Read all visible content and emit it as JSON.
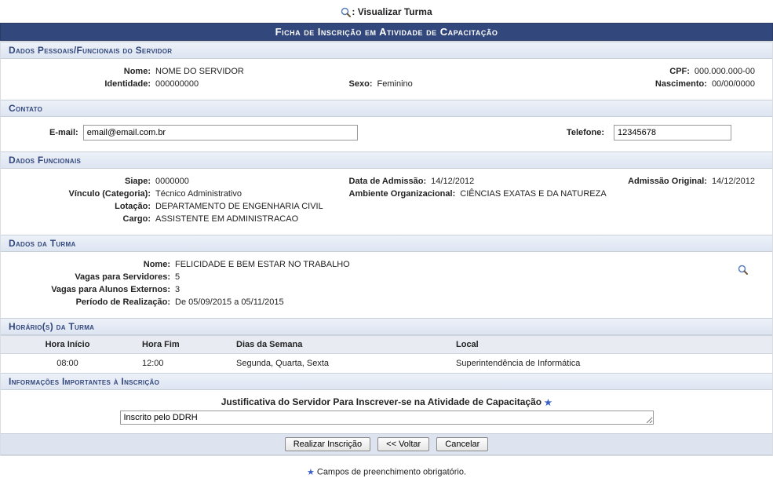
{
  "top_link": {
    "label": ": Visualizar Turma"
  },
  "main_header": "Ficha de Inscrição em Atividade de Capacitação",
  "sections": {
    "pessoais_header": "Dados Pessoais/Funcionais do Servidor",
    "contato_header": "Contato",
    "funcionais_header": "Dados Funcionais",
    "turma_header": "Dados da Turma",
    "horarios_header": "Horário(s) da Turma",
    "info_header": "Informações Importantes à Inscrição"
  },
  "pessoais": {
    "nome_label": "Nome:",
    "nome_value": "NOME DO SERVIDOR",
    "cpf_label": "CPF:",
    "cpf_value": "000.000.000-00",
    "identidade_label": "Identidade:",
    "identidade_value": "000000000",
    "sexo_label": "Sexo:",
    "sexo_value": "Feminino",
    "nascimento_label": "Nascimento:",
    "nascimento_value": "00/00/0000"
  },
  "contato": {
    "email_label": "E-mail:",
    "email_value": "email@email.com.br",
    "telefone_label": "Telefone:",
    "telefone_value": "12345678"
  },
  "funcionais": {
    "siape_label": "Siape:",
    "siape_value": "0000000",
    "admissao_label": "Data de Admissão:",
    "admissao_value": "14/12/2012",
    "admissao_orig_label": "Admissão Original:",
    "admissao_orig_value": "14/12/2012",
    "vinculo_label": "Vínculo (Categoria):",
    "vinculo_value": "Técnico Administrativo",
    "ambiente_label": "Ambiente Organizacional:",
    "ambiente_value": "CIÊNCIAS EXATAS E DA NATUREZA",
    "lotacao_label": "Lotação:",
    "lotacao_value": "DEPARTAMENTO DE ENGENHARIA CIVIL",
    "cargo_label": "Cargo:",
    "cargo_value": "ASSISTENTE EM ADMINISTRACAO"
  },
  "turma": {
    "nome_label": "Nome:",
    "nome_value": "FELICIDADE E BEM ESTAR NO TRABALHO",
    "vagas_serv_label": "Vagas para Servidores:",
    "vagas_serv_value": "5",
    "vagas_ext_label": "Vagas para Alunos Externos:",
    "vagas_ext_value": "3",
    "periodo_label": "Período de Realização:",
    "periodo_value": "De 05/09/2015 a 05/11/2015"
  },
  "horarios": {
    "cols": {
      "inicio": "Hora Início",
      "fim": "Hora Fim",
      "dias": "Dias da Semana",
      "local": "Local"
    },
    "row": {
      "inicio": "08:00",
      "fim": "12:00",
      "dias": "Segunda, Quarta, Sexta",
      "local": "Superintendência de Informática"
    }
  },
  "justificativa": {
    "title": "Justificativa do Servidor Para Inscrever-se na Atividade de Capacitação",
    "value": "Inscrito pelo DDRH"
  },
  "buttons": {
    "realizar": "Realizar Inscrição",
    "voltar": "<< Voltar",
    "cancelar": "Cancelar"
  },
  "footnote": "Campos de preenchimento obrigatório."
}
